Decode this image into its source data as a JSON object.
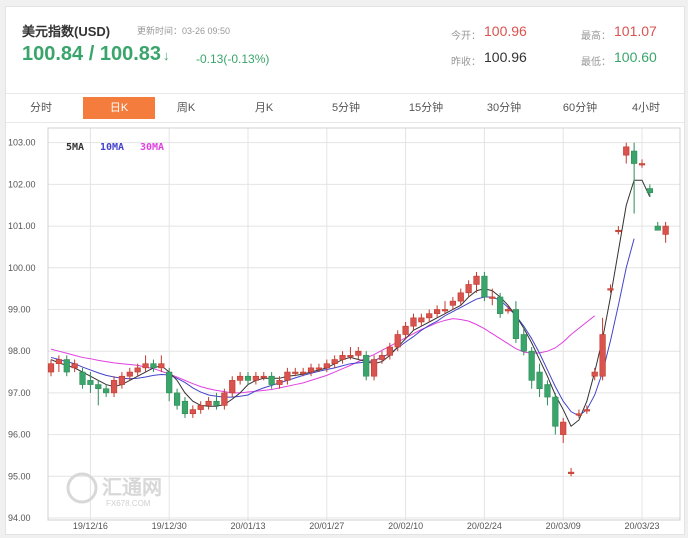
{
  "header": {
    "title": "美元指数(USD)",
    "updated": "更新时间：03-26 09:50",
    "price": "100.84 / 100.83",
    "arrow": "↓",
    "change": "-0.13(-0.13%)",
    "open_label": "今开：",
    "open": "100.96",
    "high_label": "最高：",
    "high": "101.07",
    "prev_label": "昨收：",
    "prev": "100.96",
    "low_label": "最低：",
    "low": "100.60"
  },
  "tabs": [
    "分时",
    "日K",
    "周K",
    "月K",
    "5分钟",
    "15分钟",
    "30分钟",
    "60分钟",
    "4小时"
  ],
  "active_tab": "日K",
  "legend": {
    "ma5": "5MA",
    "ma10": "10MA",
    "ma30": "30MA"
  },
  "watermark": {
    "brand": "汇通网",
    "sub": "FX678.COM"
  },
  "colors": {
    "up": "#d9534f",
    "down": "#3aa56b",
    "ma5": "#333333",
    "ma10": "#4444cc",
    "ma30": "#e040e0",
    "accent": "#f47c3c"
  },
  "chart_data": {
    "type": "candlestick",
    "y_ticks": [
      "103.00",
      "102.00",
      "101.00",
      "100.00",
      "99.00",
      "98.00",
      "97.00",
      "96.00",
      "95.00",
      "94.00"
    ],
    "ylim": [
      94,
      103.4
    ],
    "x_ticks": [
      "19/12/16",
      "19/12/30",
      "20/01/13",
      "20/01/27",
      "20/02/10",
      "20/02/24",
      "20/03/09",
      "20/03/23"
    ],
    "x_tick_index": [
      5,
      15,
      25,
      35,
      45,
      55,
      65,
      75
    ],
    "candles": [
      {
        "o": 97.5,
        "h": 97.8,
        "l": 97.4,
        "c": 97.7
      },
      {
        "o": 97.7,
        "h": 97.9,
        "l": 97.5,
        "c": 97.8
      },
      {
        "o": 97.8,
        "h": 97.9,
        "l": 97.4,
        "c": 97.5
      },
      {
        "o": 97.6,
        "h": 97.8,
        "l": 97.5,
        "c": 97.7
      },
      {
        "o": 97.5,
        "h": 97.6,
        "l": 97.1,
        "c": 97.2
      },
      {
        "o": 97.3,
        "h": 97.5,
        "l": 97.0,
        "c": 97.2
      },
      {
        "o": 97.2,
        "h": 97.3,
        "l": 96.7,
        "c": 97.1
      },
      {
        "o": 97.1,
        "h": 97.2,
        "l": 96.9,
        "c": 97.0
      },
      {
        "o": 97.0,
        "h": 97.4,
        "l": 96.9,
        "c": 97.3
      },
      {
        "o": 97.2,
        "h": 97.5,
        "l": 97.1,
        "c": 97.4
      },
      {
        "o": 97.4,
        "h": 97.6,
        "l": 97.3,
        "c": 97.5
      },
      {
        "o": 97.5,
        "h": 97.7,
        "l": 97.4,
        "c": 97.6
      },
      {
        "o": 97.6,
        "h": 97.9,
        "l": 97.5,
        "c": 97.7
      },
      {
        "o": 97.7,
        "h": 97.8,
        "l": 97.5,
        "c": 97.6
      },
      {
        "o": 97.6,
        "h": 97.9,
        "l": 97.5,
        "c": 97.7
      },
      {
        "o": 97.5,
        "h": 97.6,
        "l": 96.8,
        "c": 97.0
      },
      {
        "o": 97.0,
        "h": 97.1,
        "l": 96.6,
        "c": 96.7
      },
      {
        "o": 96.8,
        "h": 96.9,
        "l": 96.4,
        "c": 96.5
      },
      {
        "o": 96.5,
        "h": 96.7,
        "l": 96.4,
        "c": 96.6
      },
      {
        "o": 96.6,
        "h": 96.8,
        "l": 96.5,
        "c": 96.7
      },
      {
        "o": 96.7,
        "h": 96.9,
        "l": 96.6,
        "c": 96.8
      },
      {
        "o": 96.8,
        "h": 97.0,
        "l": 96.6,
        "c": 96.7
      },
      {
        "o": 96.7,
        "h": 97.1,
        "l": 96.6,
        "c": 97.0
      },
      {
        "o": 97.0,
        "h": 97.4,
        "l": 96.9,
        "c": 97.3
      },
      {
        "o": 97.3,
        "h": 97.5,
        "l": 97.2,
        "c": 97.4
      },
      {
        "o": 97.4,
        "h": 97.5,
        "l": 97.2,
        "c": 97.3
      },
      {
        "o": 97.3,
        "h": 97.5,
        "l": 97.2,
        "c": 97.4
      },
      {
        "o": 97.4,
        "h": 97.5,
        "l": 97.3,
        "c": 97.4
      },
      {
        "o": 97.4,
        "h": 97.5,
        "l": 97.1,
        "c": 97.2
      },
      {
        "o": 97.2,
        "h": 97.4,
        "l": 97.1,
        "c": 97.3
      },
      {
        "o": 97.3,
        "h": 97.6,
        "l": 97.2,
        "c": 97.5
      },
      {
        "o": 97.5,
        "h": 97.6,
        "l": 97.4,
        "c": 97.5
      },
      {
        "o": 97.5,
        "h": 97.6,
        "l": 97.4,
        "c": 97.5
      },
      {
        "o": 97.5,
        "h": 97.7,
        "l": 97.4,
        "c": 97.6
      },
      {
        "o": 97.6,
        "h": 97.7,
        "l": 97.5,
        "c": 97.6
      },
      {
        "o": 97.6,
        "h": 97.8,
        "l": 97.5,
        "c": 97.7
      },
      {
        "o": 97.7,
        "h": 97.9,
        "l": 97.6,
        "c": 97.8
      },
      {
        "o": 97.8,
        "h": 98.0,
        "l": 97.7,
        "c": 97.9
      },
      {
        "o": 97.9,
        "h": 98.1,
        "l": 97.8,
        "c": 97.9
      },
      {
        "o": 97.9,
        "h": 98.1,
        "l": 97.8,
        "c": 98.0
      },
      {
        "o": 97.9,
        "h": 98.0,
        "l": 97.3,
        "c": 97.4
      },
      {
        "o": 97.4,
        "h": 97.9,
        "l": 97.3,
        "c": 97.8
      },
      {
        "o": 97.8,
        "h": 98.0,
        "l": 97.7,
        "c": 97.9
      },
      {
        "o": 97.9,
        "h": 98.2,
        "l": 97.8,
        "c": 98.1
      },
      {
        "o": 98.1,
        "h": 98.5,
        "l": 98.0,
        "c": 98.4
      },
      {
        "o": 98.4,
        "h": 98.7,
        "l": 98.3,
        "c": 98.6
      },
      {
        "o": 98.6,
        "h": 98.9,
        "l": 98.5,
        "c": 98.8
      },
      {
        "o": 98.7,
        "h": 98.9,
        "l": 98.6,
        "c": 98.8
      },
      {
        "o": 98.8,
        "h": 99.0,
        "l": 98.7,
        "c": 98.9
      },
      {
        "o": 98.9,
        "h": 99.1,
        "l": 98.8,
        "c": 99.0
      },
      {
        "o": 99.0,
        "h": 99.2,
        "l": 98.9,
        "c": 99.0
      },
      {
        "o": 99.1,
        "h": 99.3,
        "l": 99.0,
        "c": 99.2
      },
      {
        "o": 99.2,
        "h": 99.5,
        "l": 99.1,
        "c": 99.4
      },
      {
        "o": 99.4,
        "h": 99.7,
        "l": 99.3,
        "c": 99.6
      },
      {
        "o": 99.6,
        "h": 99.9,
        "l": 99.4,
        "c": 99.8
      },
      {
        "o": 99.8,
        "h": 99.9,
        "l": 99.2,
        "c": 99.3
      },
      {
        "o": 99.3,
        "h": 99.5,
        "l": 99.1,
        "c": 99.3
      },
      {
        "o": 99.3,
        "h": 99.4,
        "l": 98.8,
        "c": 98.9
      },
      {
        "o": 99.0,
        "h": 99.1,
        "l": 98.9,
        "c": 99.0
      },
      {
        "o": 99.0,
        "h": 99.2,
        "l": 98.2,
        "c": 98.3
      },
      {
        "o": 98.4,
        "h": 98.6,
        "l": 97.9,
        "c": 98.0
      },
      {
        "o": 98.0,
        "h": 98.1,
        "l": 97.1,
        "c": 97.3
      },
      {
        "o": 97.5,
        "h": 97.7,
        "l": 96.9,
        "c": 97.1
      },
      {
        "o": 97.2,
        "h": 97.3,
        "l": 96.7,
        "c": 96.9
      },
      {
        "o": 96.9,
        "h": 97.0,
        "l": 96.0,
        "c": 96.2
      },
      {
        "o": 96.0,
        "h": 96.4,
        "l": 95.8,
        "c": 96.3
      },
      {
        "o": 95.1,
        "h": 95.2,
        "l": 95.0,
        "c": 95.1
      },
      {
        "o": 96.5,
        "h": 96.6,
        "l": 96.4,
        "c": 96.5
      },
      {
        "o": 96.6,
        "h": 96.7,
        "l": 96.5,
        "c": 96.6
      },
      {
        "o": 97.4,
        "h": 97.6,
        "l": 97.3,
        "c": 97.5
      },
      {
        "o": 97.4,
        "h": 98.8,
        "l": 97.3,
        "c": 98.4
      },
      {
        "o": 99.5,
        "h": 99.6,
        "l": 99.4,
        "c": 99.5
      },
      {
        "o": 100.9,
        "h": 101.0,
        "l": 100.8,
        "c": 100.9
      },
      {
        "o": 102.7,
        "h": 103.0,
        "l": 102.5,
        "c": 102.9
      },
      {
        "o": 102.8,
        "h": 103.0,
        "l": 101.3,
        "c": 102.5
      },
      {
        "o": 102.5,
        "h": 102.6,
        "l": 102.4,
        "c": 102.5
      },
      {
        "o": 101.9,
        "h": 102.0,
        "l": 101.7,
        "c": 101.8
      },
      {
        "o": 101.0,
        "h": 101.1,
        "l": 100.9,
        "c": 100.9
      },
      {
        "o": 100.8,
        "h": 101.1,
        "l": 100.6,
        "c": 101.0
      }
    ],
    "ma5": [
      97.8,
      97.72,
      97.66,
      97.6,
      97.5,
      97.4,
      97.3,
      97.2,
      97.15,
      97.2,
      97.3,
      97.4,
      97.5,
      97.6,
      97.65,
      97.5,
      97.3,
      97.0,
      96.8,
      96.7,
      96.68,
      96.68,
      96.72,
      96.85,
      97.0,
      97.2,
      97.3,
      97.35,
      97.35,
      97.35,
      97.4,
      97.42,
      97.45,
      97.5,
      97.55,
      97.6,
      97.7,
      97.8,
      97.85,
      97.8,
      97.75,
      97.7,
      97.75,
      97.9,
      98.1,
      98.3,
      98.5,
      98.6,
      98.7,
      98.8,
      98.9,
      99.0,
      99.1,
      99.3,
      99.45,
      99.5,
      99.45,
      99.3,
      99.1,
      98.85,
      98.55,
      98.2,
      97.8,
      97.4,
      96.95,
      96.6,
      96.2,
      96.35,
      96.8,
      97.5,
      98.3,
      99.3,
      100.4,
      101.5,
      102.1,
      102.1,
      101.7
    ],
    "ma10": [
      97.85,
      97.8,
      97.75,
      97.7,
      97.62,
      97.55,
      97.48,
      97.42,
      97.38,
      97.35,
      97.34,
      97.35,
      97.38,
      97.42,
      97.44,
      97.43,
      97.35,
      97.25,
      97.12,
      97.02,
      96.95,
      96.92,
      96.9,
      96.9,
      96.92,
      96.95,
      97.05,
      97.12,
      97.18,
      97.24,
      97.3,
      97.36,
      97.42,
      97.47,
      97.52,
      97.56,
      97.6,
      97.65,
      97.7,
      97.72,
      97.74,
      97.78,
      97.85,
      97.95,
      98.08,
      98.22,
      98.35,
      98.5,
      98.62,
      98.72,
      98.85,
      98.95,
      99.05,
      99.15,
      99.25,
      99.3,
      99.3,
      99.22,
      99.05,
      98.85,
      98.6,
      98.3,
      97.95,
      97.55,
      97.15,
      96.8,
      96.55,
      96.45,
      96.6,
      96.95,
      97.5,
      98.25,
      99.1,
      100.0,
      100.7
    ],
    "ma30": [
      98.05,
      98.0,
      97.95,
      97.9,
      97.85,
      97.82,
      97.78,
      97.75,
      97.72,
      97.7,
      97.68,
      97.66,
      97.62,
      97.58,
      97.52,
      97.45,
      97.38,
      97.3,
      97.22,
      97.15,
      97.1,
      97.06,
      97.03,
      97.0,
      97.0,
      97.02,
      97.04,
      97.06,
      97.08,
      97.12,
      97.16,
      97.2,
      97.24,
      97.3,
      97.36,
      97.42,
      97.5,
      97.58,
      97.66,
      97.75,
      97.84,
      97.92,
      98.02,
      98.12,
      98.22,
      98.32,
      98.42,
      98.52,
      98.6,
      98.68,
      98.74,
      98.78,
      98.76,
      98.72,
      98.64,
      98.54,
      98.42,
      98.3,
      98.18,
      98.06,
      97.98,
      97.95,
      97.96,
      98.0,
      98.08,
      98.22,
      98.4,
      98.55,
      98.7,
      98.85
    ]
  }
}
